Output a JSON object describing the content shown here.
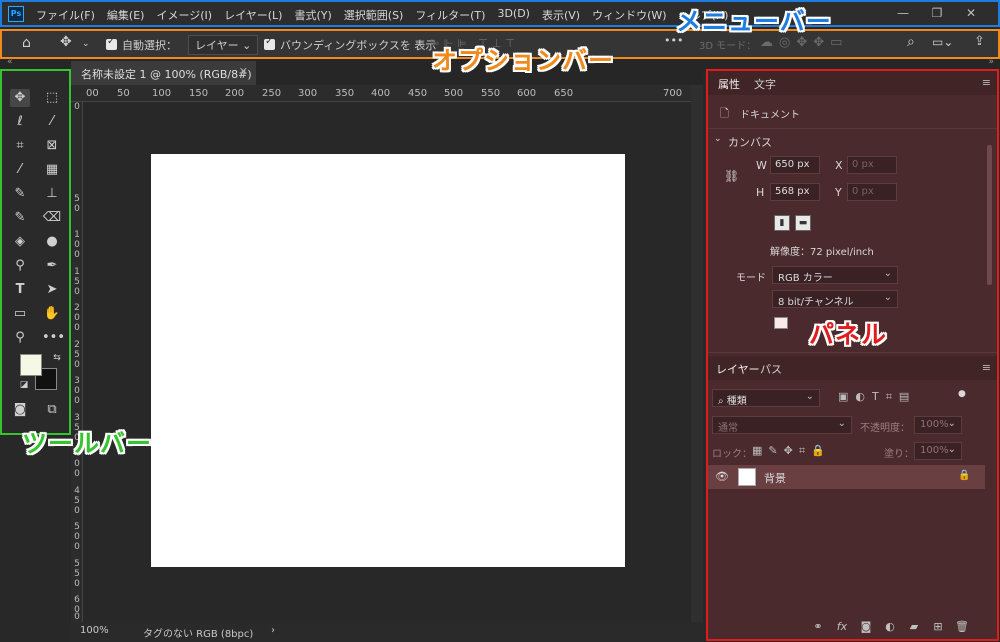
{
  "annotations": {
    "menu_bar": "メニューバー",
    "options_bar": "オプションバー",
    "tool_bar": "ツールバー",
    "panel": "パネル"
  },
  "app": {
    "logo": "Ps"
  },
  "menu": [
    "ファイル(F)",
    "編集(E)",
    "イメージ(I)",
    "レイヤー(L)",
    "書式(Y)",
    "選択範囲(S)",
    "フィルター(T)",
    "3D(D)",
    "表示(V)",
    "ウィンドウ(W)",
    "ヘルプ(H)"
  ],
  "options": {
    "auto_select_label": "自動選択：",
    "auto_select_value": "レイヤー",
    "bounding_box_label": "バウンディングボックスを 表示",
    "mode_3d_label": "3D モード：",
    "more": "•••"
  },
  "document": {
    "tab_title": "名称未設定 1 @ 100% (RGB/8#)",
    "ruler_top": [
      "00",
      "50",
      "100",
      "150",
      "200",
      "250",
      "300",
      "350",
      "400",
      "450",
      "500",
      "550",
      "600",
      "650",
      "700"
    ],
    "ruler_left": [
      "0",
      "5",
      "0",
      "1",
      "0",
      "0",
      "1",
      "5",
      "0",
      "2",
      "0",
      "0",
      "2",
      "5",
      "0",
      "3",
      "0",
      "0",
      "3",
      "5",
      "0",
      "4",
      "0",
      "0",
      "4",
      "5",
      "0",
      "5",
      "0",
      "0",
      "5",
      "5",
      "0",
      "6",
      "0",
      "0"
    ],
    "status_zoom": "100%",
    "status_info": "タグのない RGB (8bpc)",
    "status_arrow": "›"
  },
  "properties_panel": {
    "tabs": [
      "属性",
      "文字"
    ],
    "doc_label": "ドキュメント",
    "canvas_section": "カンバス",
    "w_label": "W",
    "w_value": "650 px",
    "h_label": "H",
    "h_value": "568 px",
    "x_label": "X",
    "x_value": "0 px",
    "y_label": "Y",
    "y_value": "0 px",
    "resolution": "解像度：72 pixel/inch",
    "mode_label": "モード",
    "mode_value": "RGB カラー",
    "depth_value": "8 bit/チャンネル"
  },
  "layers_panel": {
    "tabs": [
      "レイヤー",
      "パス"
    ],
    "filter_placeholder": "種類",
    "blend_mode": "通常",
    "opacity_label": "不透明度：",
    "opacity_value": "100%",
    "lock_label": "ロック：",
    "fill_label": "塗り：",
    "fill_value": "100%",
    "layer_name": "背景"
  },
  "colors": {
    "menu_border": "#1e7de0",
    "options_border": "#f08a1c",
    "toolbar_border": "#35c42d",
    "panel_border": "#e01c1c",
    "foreground": "#f4f8e4",
    "background": "#111111"
  }
}
